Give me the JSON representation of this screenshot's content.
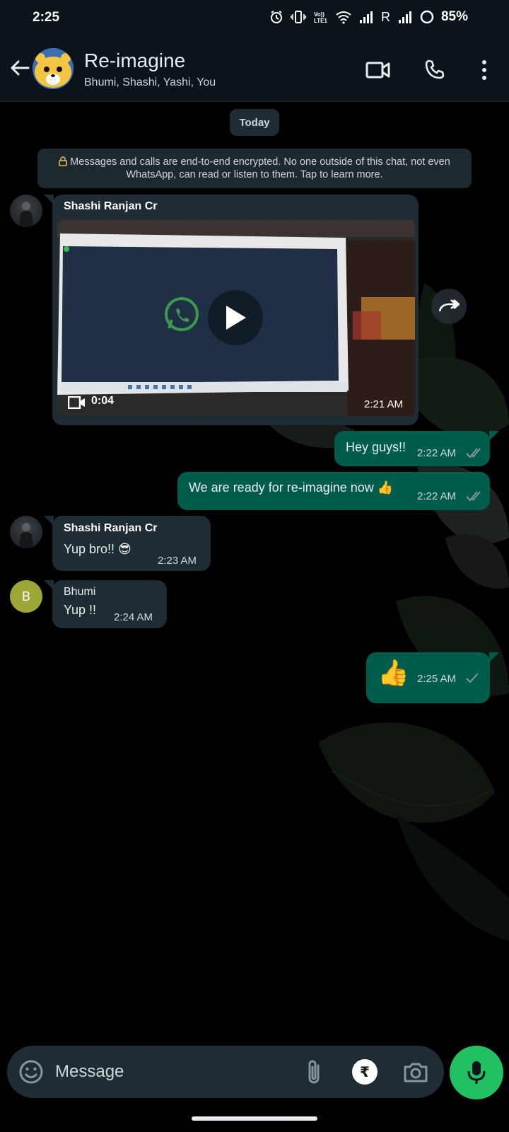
{
  "status_bar": {
    "time": "2:25",
    "network_label": "R",
    "battery": "85%"
  },
  "header": {
    "title": "Re-imagine",
    "members": "Bhumi, Shashi, Yashi, You"
  },
  "chat": {
    "date_chip": "Today",
    "encryption_notice": "Messages and calls are end-to-end encrypted. No one outside of this chat, not even WhatsApp, can read or listen to them. Tap to learn more.",
    "messages": [
      {
        "direction": "in",
        "sender": "Shashi Ranjan Cr",
        "type": "video",
        "duration": "0:04",
        "time": "2:21 AM"
      },
      {
        "direction": "out",
        "text": "Hey guys!!",
        "time": "2:22 AM",
        "status": "read"
      },
      {
        "direction": "out",
        "text": "We are ready for re-imagine now 👍",
        "time": "2:22 AM",
        "status": "read"
      },
      {
        "direction": "in",
        "sender": "Shashi Ranjan Cr",
        "text": "Yup bro!! 😎",
        "time": "2:23 AM"
      },
      {
        "direction": "in",
        "sender": "Bhumi",
        "avatar_letter": "B",
        "text": "Yup !!",
        "time": "2:24 AM"
      },
      {
        "direction": "out",
        "text": "👍",
        "time": "2:25 AM",
        "status": "sent"
      }
    ]
  },
  "composer": {
    "placeholder": "Message",
    "payment_symbol": "₹"
  },
  "colors": {
    "header_bg": "#0b141a",
    "incoming_bubble": "#1f2c34",
    "outgoing_bubble": "#005c4b",
    "mic_button": "#21c063",
    "read_tick": "#8696a0",
    "bhumi_avatar": "#9ca738"
  },
  "icons": {
    "back": "arrow-left-icon",
    "video_call": "video-camera-icon",
    "voice_call": "phone-icon",
    "more": "vertical-dots-icon",
    "lock": "lock-icon",
    "play": "play-icon",
    "forward": "forward-icon",
    "emoji": "smiley-icon",
    "attach": "paperclip-icon",
    "camera": "camera-icon",
    "mic": "microphone-icon"
  }
}
